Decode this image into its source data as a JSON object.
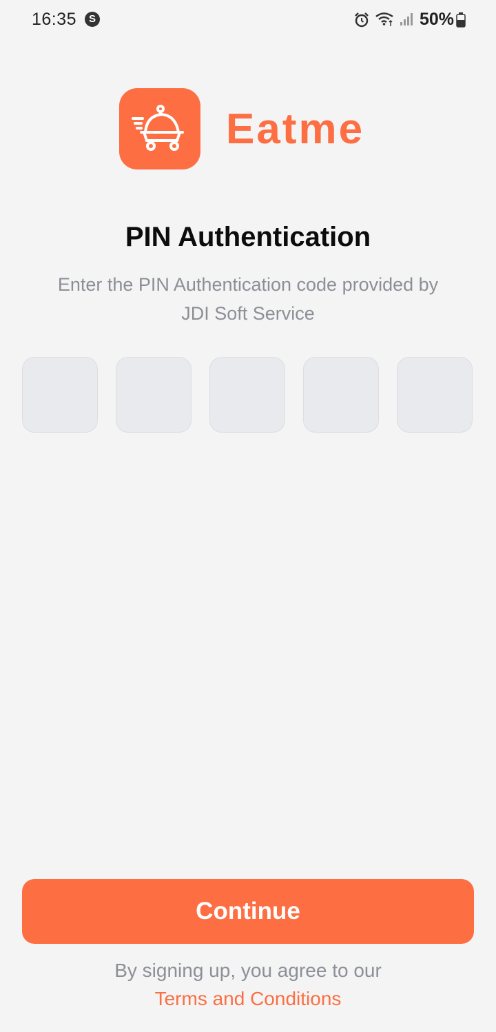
{
  "status_bar": {
    "time": "16:35",
    "notification_icon": "s-circle-icon",
    "battery_percent": "50%",
    "icons": [
      "alarm-icon",
      "wifi-icon",
      "signal-icon",
      "battery-icon"
    ]
  },
  "brand": {
    "name": "Eatme",
    "logo_icon": "food-cart-cloche-icon",
    "accent_color": "#fd6e43"
  },
  "auth": {
    "title": "PIN Authentication",
    "subtitle": "Enter the PIN Authentication code provided by JDI Soft Service",
    "pin_digits": [
      "",
      "",
      "",
      "",
      ""
    ]
  },
  "actions": {
    "continue_label": "Continue"
  },
  "footer": {
    "agreement_text": "By signing up, you agree to our",
    "terms_link": "Terms and Conditions"
  }
}
